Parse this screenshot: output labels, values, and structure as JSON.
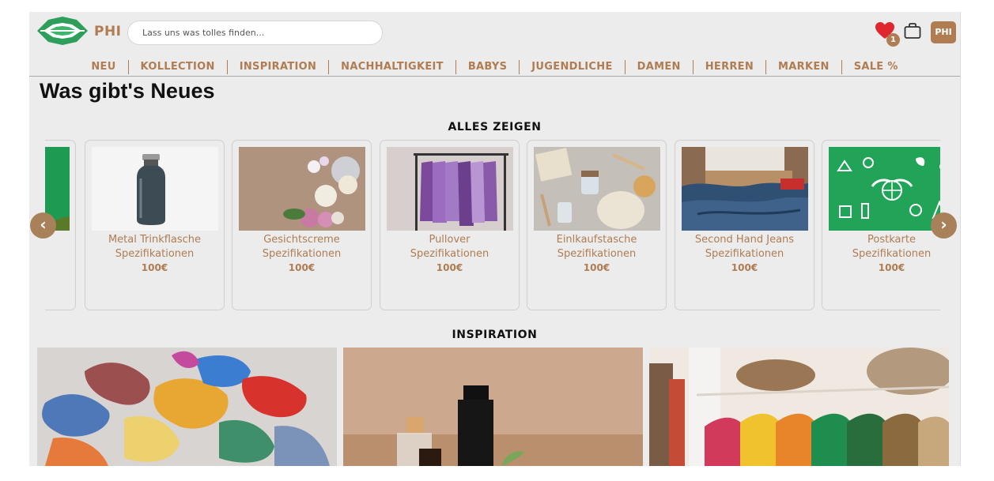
{
  "header": {
    "brand": "PHI",
    "search_placeholder": "Lass uns was tolles finden...",
    "wishlist_count": "1",
    "avatar_initials": "PHI"
  },
  "nav": {
    "items": [
      "NEU",
      "KOLLECTION",
      "INSPIRATION",
      "NACHHALTIGKEIT",
      "BABYS",
      "JUGENDLICHE",
      "DAMEN",
      "HERREN",
      "MARKEN",
      "SALE %"
    ]
  },
  "page": {
    "title": "Was gibt's Neues",
    "show_all": "ALLES ZEIGEN",
    "inspiration_heading": "INSPIRATION"
  },
  "products": [
    {
      "name": "Metal Trinkflasche",
      "spec": "Spezifikationen",
      "price": "100€"
    },
    {
      "name": "Gesichtscreme",
      "spec": "Spezifikationen",
      "price": "100€"
    },
    {
      "name": "Pullover",
      "spec": "Spezifikationen",
      "price": "100€"
    },
    {
      "name": "Einlkaufstasche",
      "spec": "Spezifikationen",
      "price": "100€"
    },
    {
      "name": "Second Hand Jeans",
      "spec": "Spezifikationen",
      "price": "100€"
    },
    {
      "name": "Postkarte",
      "spec": "Spezifikationen",
      "price": "100€"
    }
  ],
  "colors": {
    "accent": "#b07c52",
    "background": "#ececec",
    "logo_green": "#2e9e5b",
    "heart_red": "#e0262f"
  },
  "icons": {
    "prev": "chevron-left-icon",
    "next": "chevron-right-icon",
    "wishlist": "heart-icon",
    "cart": "bag-icon"
  }
}
